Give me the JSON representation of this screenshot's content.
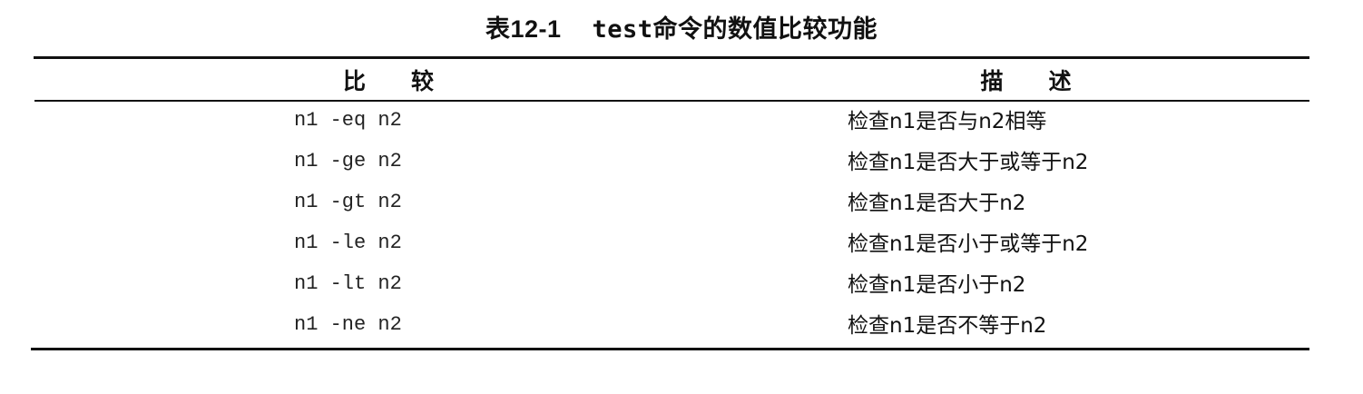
{
  "caption": {
    "number": "表12-1",
    "command": "test",
    "text": "命令的数值比较功能"
  },
  "table": {
    "headers": {
      "compare": "比　　较",
      "description": "描　　述"
    },
    "rows": [
      {
        "compare": "n1 -eq n2",
        "description": "检查n1是否与n2相等"
      },
      {
        "compare": "n1 -ge n2",
        "description": "检查n1是否大于或等于n2"
      },
      {
        "compare": "n1 -gt n2",
        "description": "检查n1是否大于n2"
      },
      {
        "compare": "n1 -le n2",
        "description": "检查n1是否小于或等于n2"
      },
      {
        "compare": "n1 -lt n2",
        "description": "检查n1是否小于n2"
      },
      {
        "compare": "n1 -ne n2",
        "description": "检查n1是否不等于n2"
      }
    ]
  }
}
